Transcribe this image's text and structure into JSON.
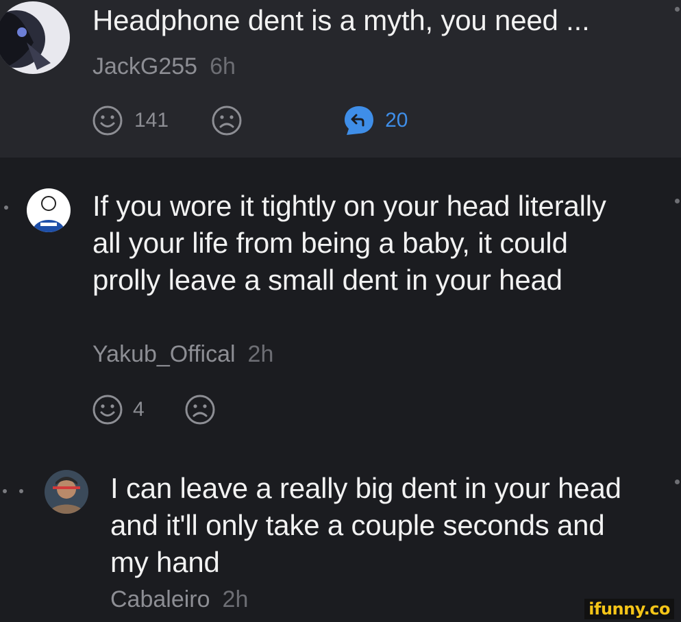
{
  "comments": [
    {
      "text": "Headphone dent is a myth, you need ...",
      "username": "JackG255",
      "age": "6h",
      "likes": "141",
      "replies": "20",
      "icons": [
        "smile-icon",
        "frown-icon",
        "reply-icon"
      ]
    },
    {
      "text": "If you wore it tightly on your head literally all your life from being a baby, it could prolly leave a small dent in your head",
      "username": "Yakub_Offical",
      "age": "2h",
      "likes": "4",
      "icons": [
        "smile-icon",
        "frown-icon"
      ]
    },
    {
      "text": "I can leave a really big dent in your head and it'll only take a couple seconds and my hand",
      "username": "Cabaleiro",
      "age": "2h"
    }
  ],
  "watermark": "ifunny.co",
  "colors": {
    "highlight_bg": "#26272c",
    "page_bg": "#1b1c20",
    "text": "#f2f2f2",
    "muted": "#8d8e94",
    "reply_accent": "#3f8ee8",
    "watermark": "#f5c518"
  }
}
